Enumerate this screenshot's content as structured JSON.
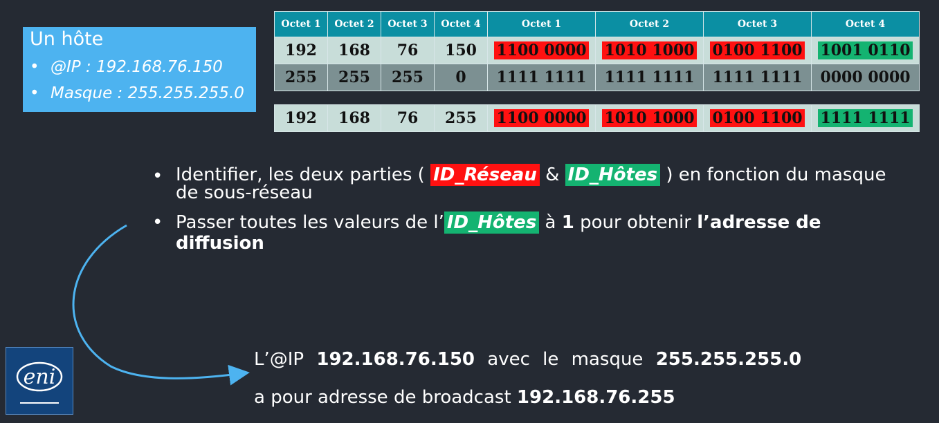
{
  "host": {
    "title": "Un hôte",
    "ip_line": "@IP : 192.168.76.150",
    "mask_line": "Masque : 255.255.255.0"
  },
  "table": {
    "headers": [
      "Octet 1",
      "Octet 2",
      "Octet 3",
      "Octet 4",
      "Octet 1",
      "Octet 2",
      "Octet 3",
      "Octet 4"
    ],
    "ip_row": [
      "192",
      "168",
      "76",
      "150",
      "1100 0000",
      "1010 1000",
      "0100 1100",
      "1001 0110"
    ],
    "mask_row": [
      "255",
      "255",
      "255",
      "0",
      "1111 1111",
      "1111 1111",
      "1111 1111",
      "0000 0000"
    ],
    "broadcast_row": [
      "192",
      "168",
      "76",
      "255",
      "1100 0000",
      "1010 1000",
      "0100 1100",
      "1111 1111"
    ]
  },
  "bullets": {
    "b1_pre": "Identifier, les deux parties ( ",
    "b1_network": "ID_Réseau",
    "b1_amp": " & ",
    "b1_host": "ID_Hôtes",
    "b1_post": " ) en fonction du masque de sous-réseau",
    "b2_pre": "Passer toutes les valeurs de l’",
    "b2_host": "ID_Hôtes",
    "b2_mid": " à ",
    "b2_one": "1",
    "b2_mid2": " pour obtenir ",
    "b2_bold": "l’adresse de diffusion"
  },
  "result": {
    "l1_pre": "L’@IP ",
    "l1_ip": "192.168.76.150",
    "l1_mid": " avec le masque ",
    "l1_mask": "255.255.255.0",
    "l2_pre": "a pour adresse de broadcast ",
    "l2_broadcast": "192.168.76.255"
  },
  "logo": {
    "text": "eni"
  },
  "colors": {
    "background": "#252a33",
    "host_box": "#4db3f0",
    "network_highlight": "#ff1111",
    "host_highlight": "#14b371",
    "table_header": "#0b8fa3"
  }
}
